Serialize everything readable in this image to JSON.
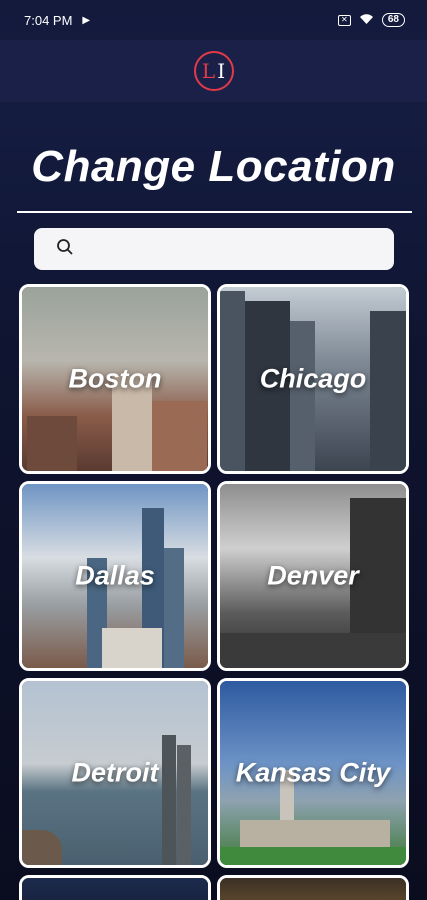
{
  "status_bar": {
    "time": "7:04 PM",
    "battery": "68"
  },
  "header": {
    "logo_text_left": "L",
    "logo_text_right": "I"
  },
  "page": {
    "title": "Change Location"
  },
  "search": {
    "placeholder": "",
    "value": ""
  },
  "cities": [
    {
      "name": "Boston"
    },
    {
      "name": "Chicago"
    },
    {
      "name": "Dallas"
    },
    {
      "name": "Denver"
    },
    {
      "name": "Detroit"
    },
    {
      "name": "Kansas City"
    }
  ],
  "colors": {
    "accent": "#e23a48",
    "background": "#141a3c",
    "header": "#1a2048"
  }
}
